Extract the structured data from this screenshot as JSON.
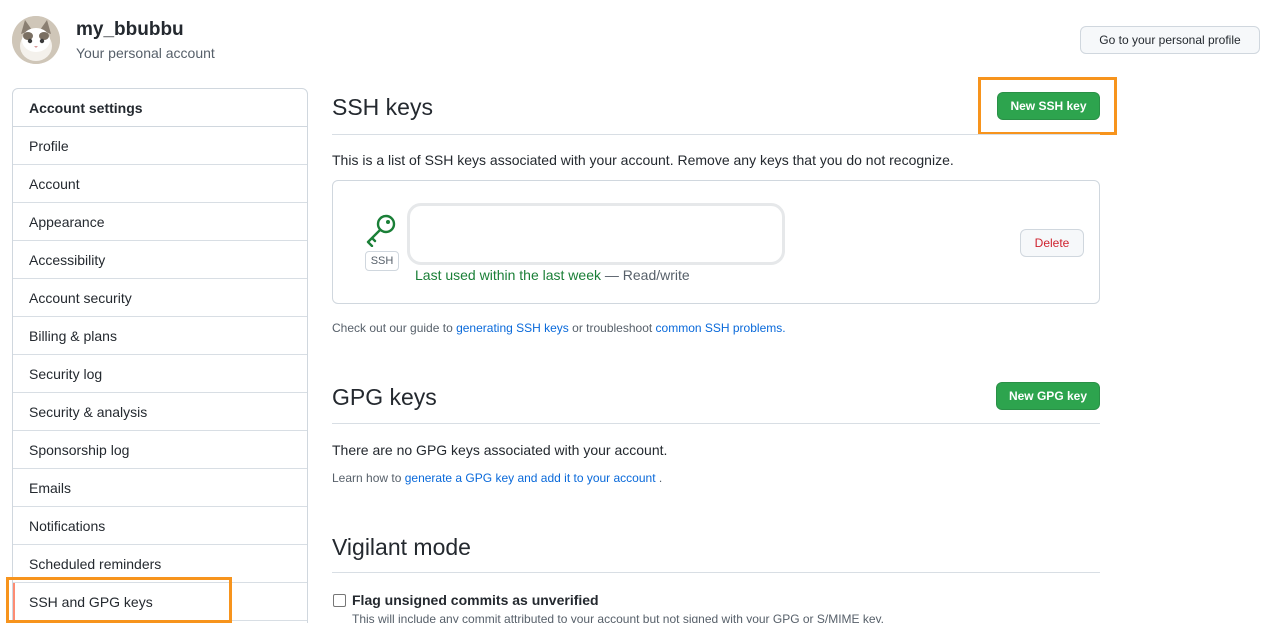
{
  "header": {
    "account_name": "my_bbubbu",
    "account_subtitle": "Your personal account",
    "profile_button": "Go to your personal profile"
  },
  "sidebar": {
    "heading": "Account settings",
    "items": [
      {
        "label": "Profile"
      },
      {
        "label": "Account"
      },
      {
        "label": "Appearance"
      },
      {
        "label": "Accessibility"
      },
      {
        "label": "Account security"
      },
      {
        "label": "Billing & plans"
      },
      {
        "label": "Security log"
      },
      {
        "label": "Security & analysis"
      },
      {
        "label": "Sponsorship log"
      },
      {
        "label": "Emails"
      },
      {
        "label": "Notifications"
      },
      {
        "label": "Scheduled reminders"
      },
      {
        "label": "SSH and GPG keys",
        "active": true
      }
    ]
  },
  "ssh": {
    "title": "SSH keys",
    "new_button": "New SSH key",
    "description": "This is a list of SSH keys associated with your account. Remove any keys that you do not recognize.",
    "key": {
      "badge": "SSH",
      "last_used": "Last used within the last week",
      "access": " — Read/write",
      "delete_button": "Delete"
    },
    "guide_prefix": "Check out our guide to ",
    "guide_link1": "generating SSH keys",
    "guide_middle": " or troubleshoot ",
    "guide_link2": "common SSH problems",
    "guide_suffix": "."
  },
  "gpg": {
    "title": "GPG keys",
    "new_button": "New GPG key",
    "empty_text": "There are no GPG keys associated with your account.",
    "learn_prefix": "Learn how to ",
    "learn_link": "generate a GPG key and add it to your account",
    "learn_suffix": " ."
  },
  "vigilant": {
    "title": "Vigilant mode",
    "checkbox_label": "Flag unsigned commits as unverified",
    "checkbox_description": "This will include any commit attributed to your account but not signed with your GPG or S/MIME key."
  },
  "colors": {
    "green_button": "#2da44e",
    "highlight": "#f7941d",
    "link": "#0969da",
    "danger": "#cf222e"
  }
}
